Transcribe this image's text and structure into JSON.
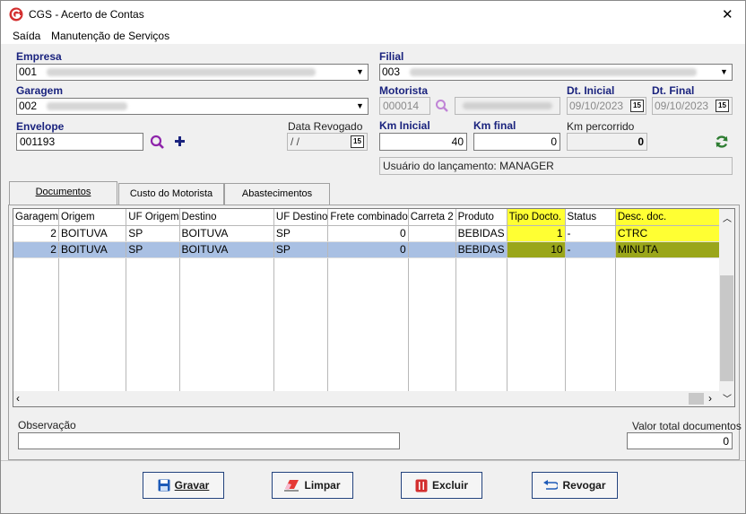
{
  "window": {
    "title": "CGS - Acerto de Contas",
    "close_glyph": "✕"
  },
  "menu": {
    "items": [
      "Saída",
      "Manutenção de Serviços"
    ]
  },
  "form": {
    "empresa": {
      "label": "Empresa",
      "value": "001"
    },
    "filial": {
      "label": "Filial",
      "value": "003"
    },
    "garagem": {
      "label": "Garagem",
      "value": "002"
    },
    "motorista": {
      "label": "Motorista",
      "value": "000014"
    },
    "dt_inicial": {
      "label": "Dt. Inicial",
      "value": "09/10/2023"
    },
    "dt_final": {
      "label": "Dt. Final",
      "value": "09/10/2023"
    },
    "envelope": {
      "label": "Envelope",
      "value": "001193"
    },
    "data_revogado": {
      "label": "Data Revogado",
      "value": " / /"
    },
    "km_inicial": {
      "label": "Km Inicial",
      "value": "40"
    },
    "km_final": {
      "label": "Km final",
      "value": "0"
    },
    "km_percorrido": {
      "label": "Km percorrido",
      "value": "0"
    },
    "usuario": "Usuário do lançamento: MANAGER",
    "calendar_glyph": "15"
  },
  "tabs": [
    "Documentos",
    "Custo do Motorista",
    "Abastecimentos"
  ],
  "grid": {
    "columns": [
      "Garagem",
      "Origem",
      "UF Origem",
      "Destino",
      "UF Destino",
      "Frete combinado",
      "Carreta 2",
      "Produto",
      "Tipo Docto.",
      "Status",
      "Desc. doc."
    ],
    "rows": [
      [
        "2",
        "BOITUVA",
        "SP",
        "BOITUVA",
        "SP",
        "0",
        "",
        "BEBIDAS",
        "1",
        "-",
        "CTRC"
      ],
      [
        "2",
        "BOITUVA",
        "SP",
        "BOITUVA",
        "SP",
        "0",
        "",
        "BEBIDAS",
        "10",
        "-",
        "MINUTA"
      ]
    ],
    "highlight_color": "#ffff33",
    "selected_row_color": "#a9c0e3"
  },
  "observacao": {
    "label": "Observação",
    "value": ""
  },
  "valor_total": {
    "label": "Valor total documentos",
    "value": "0"
  },
  "buttons": {
    "gravar": "Gravar",
    "limpar": "Limpar",
    "excluir": "Excluir",
    "revogar": "Revogar"
  },
  "colors": {
    "label_blue": "#1a237e",
    "accent_purple": "#8e24aa",
    "logo_red": "#d32f2f",
    "refresh_green": "#2e7d32"
  }
}
